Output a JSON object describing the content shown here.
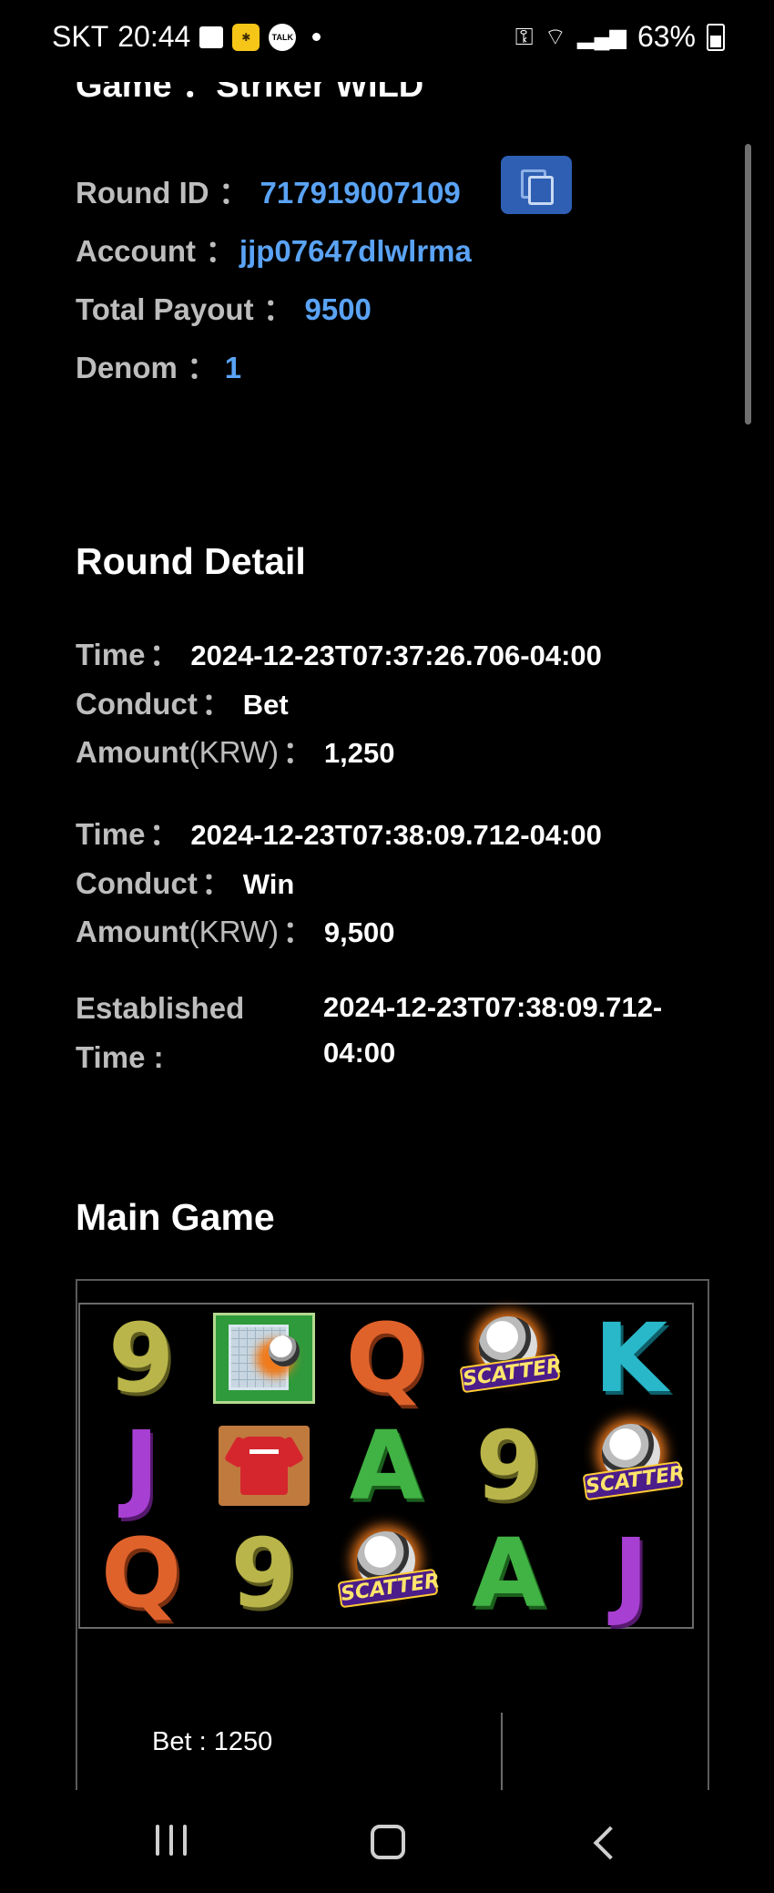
{
  "status_bar": {
    "carrier": "SKT",
    "time": "20:44",
    "battery": "63%",
    "icons": [
      "gallery-icon",
      "kakao-icon",
      "talk-icon",
      "notification-dot",
      "vpn-key-icon",
      "wifi-icon",
      "signal-icon",
      "battery-icon"
    ],
    "talk_icon_text": "TALK"
  },
  "header": {
    "game_label": "Game",
    "colon": "：",
    "game_name": "Striker WILD"
  },
  "info": {
    "round_id_label": "Round ID",
    "round_id": "717919007109",
    "account_label": "Account",
    "account": "jjp07647dlwlrma",
    "total_payout_label": "Total Payout",
    "total_payout": "9500",
    "denom_label": "Denom",
    "denom": "1",
    "colon": "："
  },
  "round_detail": {
    "title": "Round Detail",
    "time_label": "Time",
    "conduct_label": "Conduct",
    "amount_label": "Amount",
    "amount_unit": "(KRW)",
    "colon": "：",
    "entries": [
      {
        "time": "2024-12-23T07:37:26.706-04:00",
        "conduct": "Bet",
        "amount": "1,250"
      },
      {
        "time": "2024-12-23T07:38:09.712-04:00",
        "conduct": "Win",
        "amount": "9,500"
      }
    ],
    "established_label_1": "Established",
    "established_label_2": "Time :",
    "established_value_1": "2024-12-23T07:38:09.712-",
    "established_value_2": "04:00"
  },
  "main_game": {
    "title": "Main Game",
    "reels": [
      [
        "9",
        "goal",
        "Q",
        "scatter",
        "K"
      ],
      [
        "J",
        "jersey",
        "A",
        "9",
        "scatter"
      ],
      [
        "Q",
        "9",
        "scatter",
        "A",
        "J"
      ]
    ],
    "scatter_text": "SCATTER",
    "bet_text": "Bet : 1250"
  },
  "nav": {
    "recent": "recent-apps-icon",
    "home": "home-icon",
    "back": "back-icon"
  }
}
